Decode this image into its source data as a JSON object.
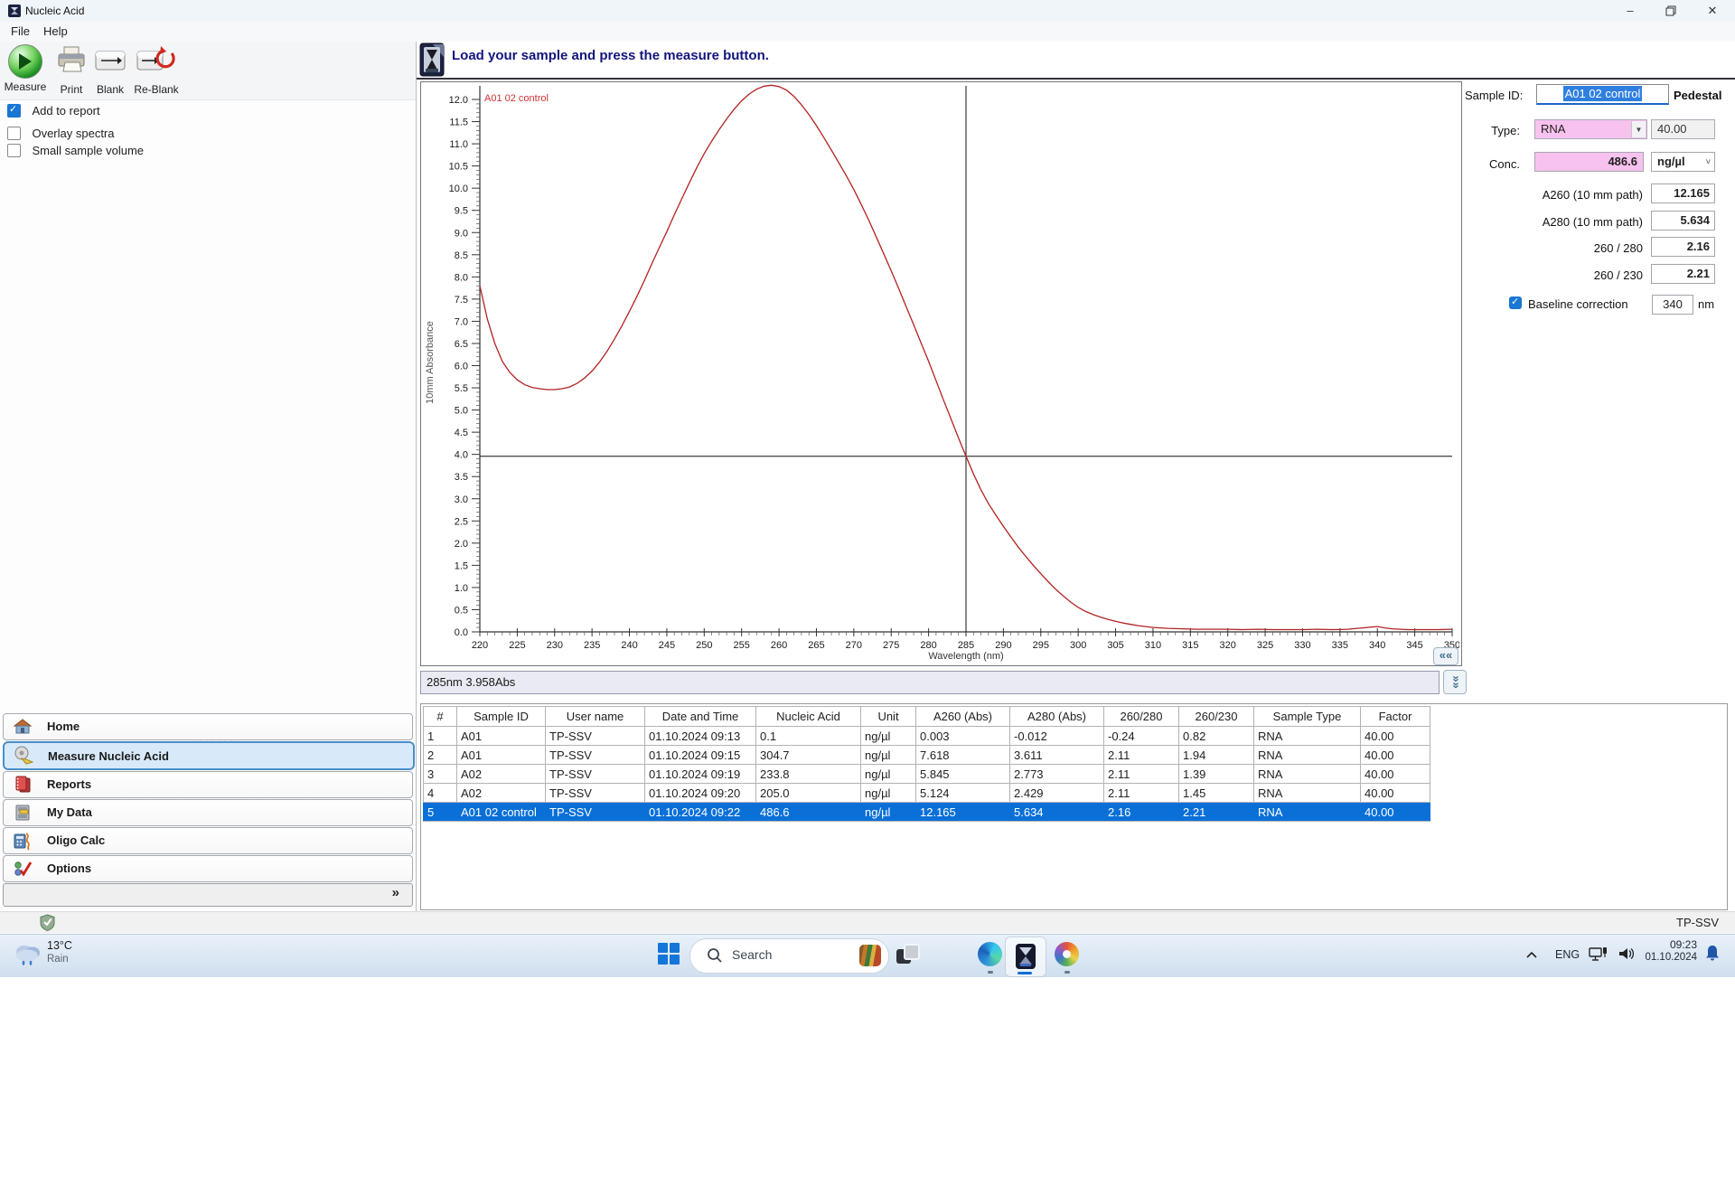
{
  "window": {
    "title": "Nucleic Acid"
  },
  "menu": {
    "items": [
      "File",
      "Help"
    ]
  },
  "toolbar": {
    "buttons": [
      {
        "label": "Measure"
      },
      {
        "label": "Print"
      },
      {
        "label": "Blank"
      },
      {
        "label": "Re-Blank"
      }
    ]
  },
  "options": {
    "checkboxes": [
      {
        "label": "Add to report",
        "checked": true
      },
      {
        "label": "Overlay spectra",
        "checked": false
      },
      {
        "label": "Small sample volume",
        "checked": false
      }
    ]
  },
  "nav": {
    "items": [
      {
        "label": "Home",
        "selected": false
      },
      {
        "label": "Measure Nucleic Acid",
        "selected": true
      },
      {
        "label": "Reports",
        "selected": false
      },
      {
        "label": "My Data",
        "selected": false
      },
      {
        "label": "Oligo Calc",
        "selected": false
      },
      {
        "label": "Options",
        "selected": false
      }
    ],
    "expander": "»"
  },
  "header": {
    "message": "Load your sample and press the measure button."
  },
  "chart_data": {
    "type": "line",
    "xlabel": "Wavelength (nm)",
    "ylabel": "10mm Absorbance",
    "xlim": [
      220,
      350
    ],
    "ylim": [
      0,
      12.0
    ],
    "xtick_step": 5,
    "ytick_step": 0.5,
    "grid": false,
    "crosshair": {
      "x": 285,
      "y": 3.958
    },
    "series": [
      {
        "name": "A01 02 control",
        "color": "#b22222",
        "points": [
          [
            220,
            7.8
          ],
          [
            221,
            7.05
          ],
          [
            222,
            6.5
          ],
          [
            223,
            6.1
          ],
          [
            224,
            5.85
          ],
          [
            225,
            5.68
          ],
          [
            226,
            5.57
          ],
          [
            227,
            5.51
          ],
          [
            228,
            5.48
          ],
          [
            229,
            5.46
          ],
          [
            230,
            5.46
          ],
          [
            231,
            5.48
          ],
          [
            232,
            5.52
          ],
          [
            233,
            5.6
          ],
          [
            234,
            5.72
          ],
          [
            235,
            5.88
          ],
          [
            236,
            6.08
          ],
          [
            237,
            6.32
          ],
          [
            238,
            6.6
          ],
          [
            239,
            6.9
          ],
          [
            240,
            7.22
          ],
          [
            241,
            7.56
          ],
          [
            242,
            7.92
          ],
          [
            243,
            8.3
          ],
          [
            244,
            8.66
          ],
          [
            245,
            9.02
          ],
          [
            246,
            9.4
          ],
          [
            247,
            9.76
          ],
          [
            248,
            10.12
          ],
          [
            249,
            10.46
          ],
          [
            250,
            10.78
          ],
          [
            251,
            11.06
          ],
          [
            252,
            11.32
          ],
          [
            253,
            11.56
          ],
          [
            254,
            11.78
          ],
          [
            255,
            11.97
          ],
          [
            256,
            12.12
          ],
          [
            257,
            12.23
          ],
          [
            258,
            12.3
          ],
          [
            259,
            12.32
          ],
          [
            260,
            12.29
          ],
          [
            261,
            12.21
          ],
          [
            262,
            12.07
          ],
          [
            263,
            11.88
          ],
          [
            264,
            11.66
          ],
          [
            265,
            11.41
          ],
          [
            266,
            11.14
          ],
          [
            267,
            10.86
          ],
          [
            268,
            10.57
          ],
          [
            269,
            10.28
          ],
          [
            270,
            9.97
          ],
          [
            271,
            9.63
          ],
          [
            272,
            9.28
          ],
          [
            273,
            8.9
          ],
          [
            274,
            8.52
          ],
          [
            275,
            8.14
          ],
          [
            276,
            7.74
          ],
          [
            277,
            7.33
          ],
          [
            278,
            6.92
          ],
          [
            279,
            6.51
          ],
          [
            280,
            6.1
          ],
          [
            281,
            5.66
          ],
          [
            282,
            5.22
          ],
          [
            283,
            4.8
          ],
          [
            284,
            4.37
          ],
          [
            285,
            3.958
          ],
          [
            286,
            3.56
          ],
          [
            287,
            3.2
          ],
          [
            288,
            2.89
          ],
          [
            289,
            2.63
          ],
          [
            290,
            2.38
          ],
          [
            291,
            2.14
          ],
          [
            292,
            1.91
          ],
          [
            293,
            1.7
          ],
          [
            294,
            1.5
          ],
          [
            295,
            1.31
          ],
          [
            296,
            1.13
          ],
          [
            297,
            0.96
          ],
          [
            298,
            0.81
          ],
          [
            299,
            0.67
          ],
          [
            300,
            0.55
          ],
          [
            301,
            0.46
          ],
          [
            302,
            0.39
          ],
          [
            303,
            0.33
          ],
          [
            304,
            0.28
          ],
          [
            305,
            0.24
          ],
          [
            306,
            0.2
          ],
          [
            307,
            0.17
          ],
          [
            308,
            0.14
          ],
          [
            309,
            0.12
          ],
          [
            310,
            0.1
          ],
          [
            312,
            0.08
          ],
          [
            314,
            0.07
          ],
          [
            316,
            0.06
          ],
          [
            318,
            0.06
          ],
          [
            320,
            0.06
          ],
          [
            322,
            0.05
          ],
          [
            324,
            0.06
          ],
          [
            326,
            0.05
          ],
          [
            328,
            0.05
          ],
          [
            330,
            0.05
          ],
          [
            332,
            0.06
          ],
          [
            334,
            0.05
          ],
          [
            336,
            0.06
          ],
          [
            338,
            0.09
          ],
          [
            340,
            0.12
          ],
          [
            341,
            0.09
          ],
          [
            342,
            0.07
          ],
          [
            344,
            0.05
          ],
          [
            346,
            0.05
          ],
          [
            348,
            0.05
          ],
          [
            350,
            0.06
          ]
        ]
      }
    ]
  },
  "status_line": {
    "text": "285nm 3.958Abs"
  },
  "sample_panel": {
    "sample_id_label": "Sample ID:",
    "sample_id_value": "A01 02 control",
    "mode_label": "Pedestal",
    "type_label": "Type:",
    "type_value": "RNA",
    "type_factor": "40.00",
    "conc_label": "Conc.",
    "conc_value": "486.6",
    "conc_unit": "ng/µl",
    "rows": [
      {
        "label": "A260 (10 mm path)",
        "value": "12.165"
      },
      {
        "label": "A280 (10 mm path)",
        "value": "5.634"
      },
      {
        "label": "260 / 280",
        "value": "2.16"
      },
      {
        "label": "260 / 230",
        "value": "2.21"
      }
    ],
    "baseline_label": "Baseline correction",
    "baseline_checked": true,
    "baseline_value": "340",
    "baseline_unit": "nm"
  },
  "results_table": {
    "columns": [
      "#",
      "Sample ID",
      "User name",
      "Date and Time",
      "Nucleic Acid",
      "Unit",
      "A260 (Abs)",
      "A280 (Abs)",
      "260/280",
      "260/230",
      "Sample Type",
      "Factor"
    ],
    "rows": [
      [
        "1",
        "A01",
        "TP-SSV",
        "01.10.2024 09:13",
        "0.1",
        "ng/µl",
        "0.003",
        "-0.012",
        "-0.24",
        "0.82",
        "RNA",
        "40.00"
      ],
      [
        "2",
        "A01",
        "TP-SSV",
        "01.10.2024 09:15",
        "304.7",
        "ng/µl",
        "7.618",
        "3.611",
        "2.11",
        "1.94",
        "RNA",
        "40.00"
      ],
      [
        "3",
        "A02",
        "TP-SSV",
        "01.10.2024 09:19",
        "233.8",
        "ng/µl",
        "5.845",
        "2.773",
        "2.11",
        "1.39",
        "RNA",
        "40.00"
      ],
      [
        "4",
        "A02",
        "TP-SSV",
        "01.10.2024 09:20",
        "205.0",
        "ng/µl",
        "5.124",
        "2.429",
        "2.11",
        "1.45",
        "RNA",
        "40.00"
      ],
      [
        "5",
        "A01 02 control",
        "TP-SSV",
        "01.10.2024 09:22",
        "486.6",
        "ng/µl",
        "12.165",
        "5.634",
        "2.16",
        "2.21",
        "RNA",
        "40.00"
      ]
    ],
    "selected_index": 4
  },
  "status_bar": {
    "user": "TP-SSV"
  },
  "taskbar": {
    "weather": {
      "temperature": "13°C",
      "condition": "Rain"
    },
    "search": {
      "label": "Search"
    },
    "tray": {
      "language": "ENG",
      "time": "09:23",
      "date": "01.10.2024"
    }
  }
}
